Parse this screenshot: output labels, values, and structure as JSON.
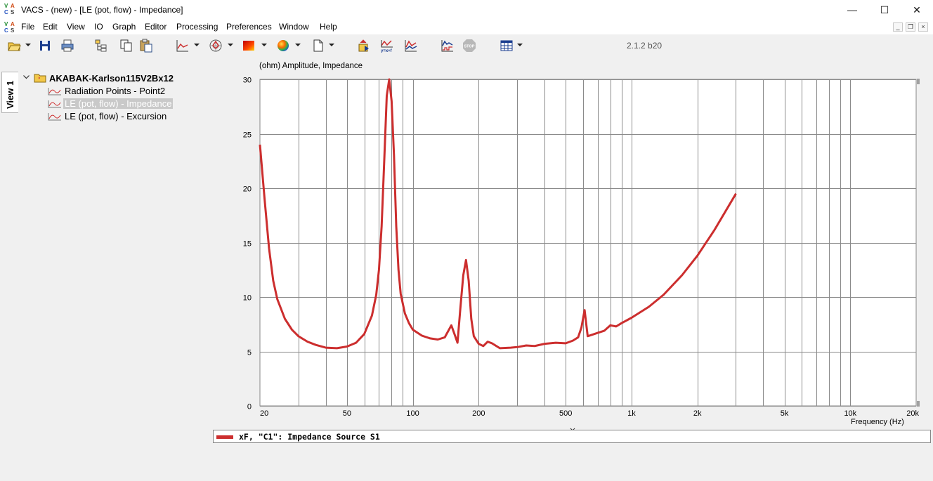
{
  "window": {
    "title": "VACS - (new) - [LE (pot, flow) - Impedance]",
    "logo_text": [
      "V",
      "A",
      "C",
      "S"
    ],
    "minimize_glyph": "—",
    "maximize_glyph": "☐",
    "close_glyph": "✕"
  },
  "menu": {
    "items": [
      "File",
      "Edit",
      "View",
      "IO",
      "Graph",
      "Editor",
      "Processing",
      "Preferences",
      "Window",
      "Help"
    ],
    "mdi_controls": [
      "_",
      "❐",
      "×"
    ]
  },
  "toolbar": {
    "version": "2.1.2 b20",
    "icons": [
      "open-folder-icon",
      "save-icon",
      "print-icon",
      "tree-view-icon",
      "copy-icon",
      "paste-icon",
      "line-graph-icon",
      "polar-graph-icon",
      "color-map-icon",
      "sphere-icon",
      "new-document-icon",
      "run-simulation-icon",
      "function-icon",
      "compare-graph-icon",
      "data-graph-icon",
      "stop-icon",
      "table-icon"
    ],
    "stop_label": "STOP"
  },
  "sidebar": {
    "view_tab": "View 1",
    "tree": {
      "root": "AKABAK-Karlson115V2Bx12",
      "items": [
        {
          "label": "Radiation Points - Point2",
          "selected": false
        },
        {
          "label": "LE (pot, flow) - Impedance",
          "selected": true
        },
        {
          "label": "LE (pot, flow) - Excursion",
          "selected": false
        }
      ]
    }
  },
  "chart": {
    "title": "(ohm)  Amplitude, Impedance",
    "xlabel": "Frequency  (Hz)",
    "legend": "xF, \"C1\": Impedance  Source S1"
  },
  "chart_data": {
    "type": "line",
    "title": "(ohm)  Amplitude, Impedance",
    "xlabel": "Frequency  (Hz)",
    "ylabel": "(ohm)",
    "x_scale": "log",
    "xlim": [
      20,
      20000
    ],
    "ylim": [
      0,
      30
    ],
    "x_ticks": [
      20,
      50,
      100,
      200,
      500,
      1000,
      2000,
      5000,
      10000,
      20000
    ],
    "x_tick_labels": [
      "20",
      "50",
      "100",
      "200",
      "500",
      "1k",
      "2k",
      "5k",
      "10k",
      "20k"
    ],
    "y_ticks": [
      0,
      5,
      10,
      15,
      20,
      25,
      30
    ],
    "y_tick_labels": [
      "0",
      "5",
      "10",
      "15",
      "20",
      "25",
      "30"
    ],
    "grid": true,
    "color": "#cc2e2e",
    "series": [
      {
        "name": "xF, \"C1\": Impedance  Source S1",
        "x": [
          20,
          21,
          22,
          23,
          24,
          26,
          28,
          30,
          33,
          36,
          40,
          45,
          50,
          55,
          60,
          65,
          68,
          70,
          72,
          74,
          76,
          78,
          80,
          82,
          84,
          86,
          88,
          92,
          96,
          100,
          110,
          120,
          130,
          140,
          150,
          155,
          160,
          165,
          170,
          175,
          180,
          185,
          190,
          200,
          210,
          220,
          230,
          250,
          280,
          300,
          330,
          360,
          400,
          450,
          500,
          540,
          570,
          590,
          610,
          630,
          700,
          750,
          800,
          850,
          900,
          1000,
          1200,
          1400,
          1700,
          2000,
          2400,
          3000
        ],
        "y": [
          24.0,
          19.0,
          14.5,
          11.5,
          9.8,
          8.0,
          7.0,
          6.4,
          5.9,
          5.6,
          5.35,
          5.3,
          5.45,
          5.8,
          6.6,
          8.3,
          10.2,
          12.5,
          16.5,
          22.5,
          28.5,
          30.0,
          28.0,
          23.0,
          16.5,
          12.5,
          10.3,
          8.5,
          7.6,
          7.0,
          6.45,
          6.2,
          6.1,
          6.3,
          7.4,
          6.6,
          5.8,
          9.0,
          12.0,
          13.4,
          11.5,
          8.0,
          6.4,
          5.7,
          5.5,
          5.9,
          5.75,
          5.3,
          5.35,
          5.4,
          5.55,
          5.5,
          5.7,
          5.8,
          5.75,
          6.0,
          6.3,
          7.2,
          8.8,
          6.4,
          6.7,
          6.9,
          7.4,
          7.3,
          7.6,
          8.1,
          9.1,
          10.2,
          12.0,
          13.8,
          16.2,
          19.5
        ]
      }
    ]
  }
}
